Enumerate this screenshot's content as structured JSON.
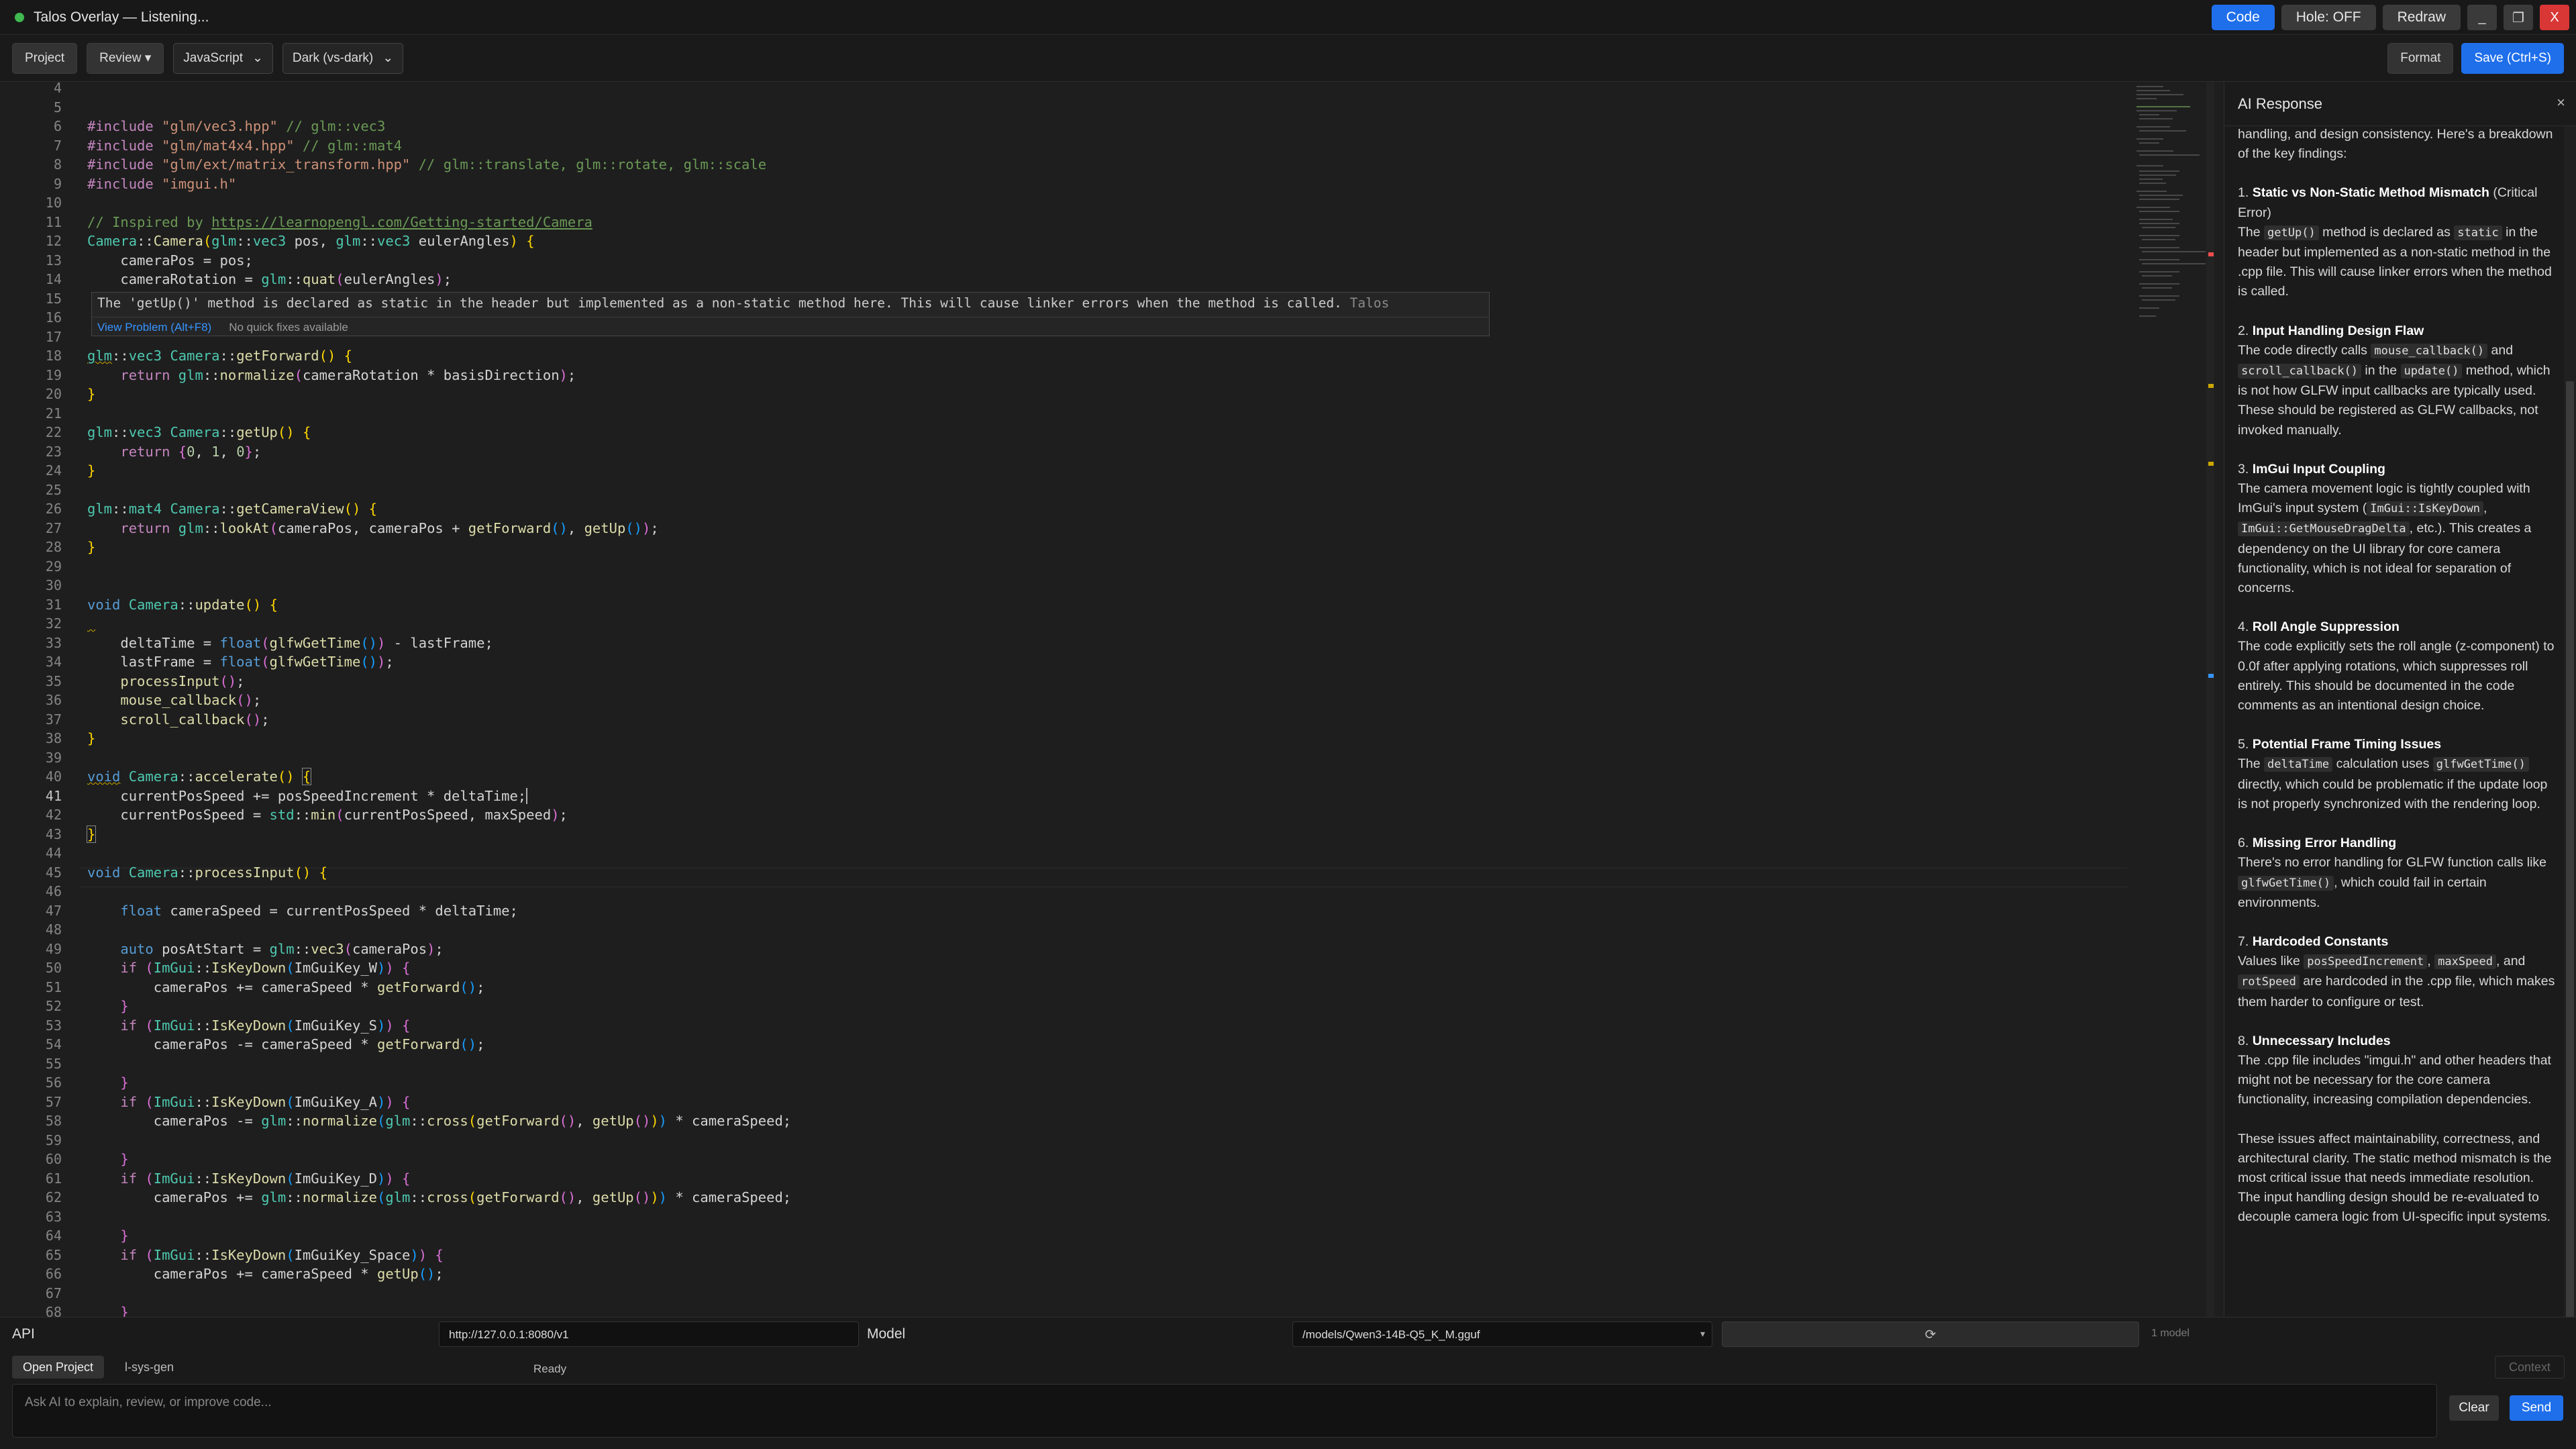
{
  "window": {
    "title": "Talos Overlay — Listening...",
    "buttons": {
      "code": "Code",
      "hole": "Hole: OFF",
      "redraw": "Redraw",
      "minimize": "_",
      "maximize": "❐",
      "close": "X"
    }
  },
  "toolbar": {
    "project": "Project",
    "review": "Review ▾",
    "language": "JavaScript",
    "theme": "Dark (vs-dark)",
    "format": "Format",
    "save": "Save (Ctrl+S)"
  },
  "editor": {
    "hover": {
      "message": "The 'getUp()' method is declared as static in the header but implemented as a non-static method here. This will cause linker errors when the method is called.",
      "source": "Talos",
      "view_problem": "View Problem (Alt+F8)",
      "no_fixes": "No quick fixes available"
    }
  },
  "ai_panel": {
    "title": "AI Response",
    "close": "×",
    "intro": "handling, and design consistency. Here's a breakdown of the key findings:",
    "items": [
      {
        "num": "1.",
        "title": "Static vs Non-Static Method Mismatch",
        "suffix": " (Critical Error)"
      },
      {
        "num": "2.",
        "title": "Input Handling Design Flaw",
        "suffix": ""
      },
      {
        "num": "3.",
        "title": "ImGui Input Coupling",
        "suffix": ""
      },
      {
        "num": "4.",
        "title": "Roll Angle Suppression",
        "suffix": ""
      },
      {
        "num": "5.",
        "title": "Potential Frame Timing Issues",
        "suffix": ""
      },
      {
        "num": "6.",
        "title": "Missing Error Handling",
        "suffix": ""
      },
      {
        "num": "7.",
        "title": "Hardcoded Constants",
        "suffix": ""
      },
      {
        "num": "8.",
        "title": "Unnecessary Includes",
        "suffix": ""
      }
    ],
    "t1a": "The ",
    "t1b": " method is declared as ",
    "t1c": " in the header but implemented as a non-static method in the .cpp file. This will cause linker errors when the method is called.",
    "t2a": "The code directly calls ",
    "t2b": " and ",
    "t2c": " in the ",
    "t2d": " method, which is not how GLFW input callbacks are typically used. These should be registered as GLFW callbacks, not invoked manually.",
    "t3a": "The camera movement logic is tightly coupled with ImGui's input system (",
    "t3b": ", ",
    "t3c": ", etc.). This creates a dependency on the UI library for core camera functionality, which is not ideal for separation of concerns.",
    "t4": "The code explicitly sets the roll angle (z-component) to 0.0f after applying rotations, which suppresses roll entirely. This should be documented in the code comments as an intentional design choice.",
    "t5a": "The ",
    "t5b": " calculation uses ",
    "t5c": " directly, which could be problematic if the update loop is not properly synchronized with the rendering loop.",
    "t6a": "There's no error handling for GLFW function calls like ",
    "t6b": ", which could fail in certain environments.",
    "t7a": "Values like ",
    "t7b": ", ",
    "t7c": ", and ",
    "t7d": " are hardcoded in the .cpp file, which makes them harder to configure or test.",
    "t8": "The .cpp file includes \"imgui.h\" and other headers that might not be necessary for the core camera functionality, increasing compilation dependencies.",
    "summary": "These issues affect maintainability, correctness, and architectural clarity. The static method mismatch is the most critical issue that needs immediate resolution. The input handling design should be re-evaluated to decouple camera logic from UI-specific input systems.",
    "code": {
      "getUp": "getUp()",
      "static": "static",
      "mouse_cb": "mouse_callback()",
      "scroll_cb": "scroll_callback()",
      "update": "update()",
      "iskeydown": "ImGui::IsKeyDown",
      "getmouse": "ImGui::GetMouseDragDelta",
      "deltaTime": "deltaTime",
      "glfwGetTime": "glfwGetTime()",
      "glfwGetTime2": "glfwGetTime()",
      "posSpeed": "posSpeedIncrement",
      "maxSpeed": "maxSpeed",
      "rotSpeed": "rotSpeed"
    }
  },
  "bottom": {
    "api_label": "API",
    "api_url": "http://127.0.0.1:8080/v1",
    "model_label": "Model",
    "model_path": "/models/Qwen3-14B-Q5_K_M.gguf",
    "refresh_icon": "⟳",
    "model_count": "1 model",
    "tab_open_project": "Open Project",
    "tab_sys_gen": "l-sys-gen",
    "status": "Ready",
    "context": "Context",
    "prompt_placeholder": "Ask AI to explain, review, or improve code...",
    "clear": "Clear",
    "send": "Send"
  },
  "colors": {
    "accent": "#1f6feb",
    "close": "#d93636",
    "status_dot": "#3fb950"
  }
}
